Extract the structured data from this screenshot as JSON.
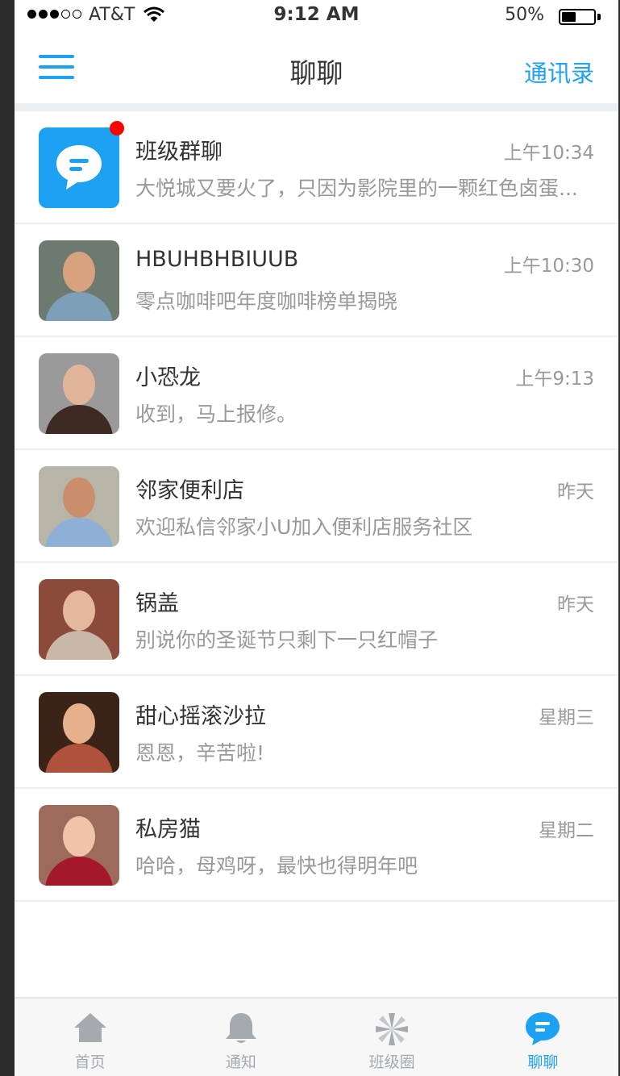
{
  "status_bar": {
    "carrier": "AT&T",
    "time": "9:12 AM",
    "battery": "50%",
    "battery_level": 0.5
  },
  "nav": {
    "title": "聊聊",
    "contacts_label": "通讯录",
    "accent_color": "#1da1f2"
  },
  "chats": [
    {
      "name": "班级群聊",
      "time": "上午10:34",
      "preview": "大悦城又要火了，只因为影院里的一颗红色卤蛋...",
      "unread": true,
      "avatar": "chat-bubble-icon"
    },
    {
      "name": "HBUHBHBIUUB",
      "time": "上午10:30",
      "preview": "零点咖啡吧年度咖啡榜单揭晓",
      "unread": false,
      "avatar": "photo-man-glasses"
    },
    {
      "name": "小恐龙",
      "time": "上午9:13",
      "preview": "收到，马上报修。",
      "unread": false,
      "avatar": "photo-woman-brown-hair"
    },
    {
      "name": "邻家便利店",
      "time": "昨天",
      "preview": "欢迎私信邻家小U加入便利店服务社区",
      "unread": false,
      "avatar": "photo-man-bald"
    },
    {
      "name": "锅盖",
      "time": "昨天",
      "preview": "别说你的圣诞节只剩下一只红帽子",
      "unread": false,
      "avatar": "photo-woman-bangs"
    },
    {
      "name": "甜心摇滚沙拉",
      "time": "星期三",
      "preview": "恩恩，辛苦啦!",
      "unread": false,
      "avatar": "photo-woman-blonde"
    },
    {
      "name": "私房猫",
      "time": "星期二",
      "preview": "哈哈，母鸡呀，最快也得明年吧",
      "unread": false,
      "avatar": "photo-woman-red"
    }
  ],
  "tabs": [
    {
      "label": "首页",
      "icon": "home-icon",
      "active": false
    },
    {
      "label": "通知",
      "icon": "bell-icon",
      "active": false
    },
    {
      "label": "班级圈",
      "icon": "pinwheel-icon",
      "active": false
    },
    {
      "label": "聊聊",
      "icon": "chat-bubble-icon",
      "active": true
    }
  ],
  "colors": {
    "accent": "#1da1f2",
    "divider": "#ebeff2",
    "name_text": "#333333",
    "secondary_text": "#999999",
    "badge": "#ff0000"
  }
}
